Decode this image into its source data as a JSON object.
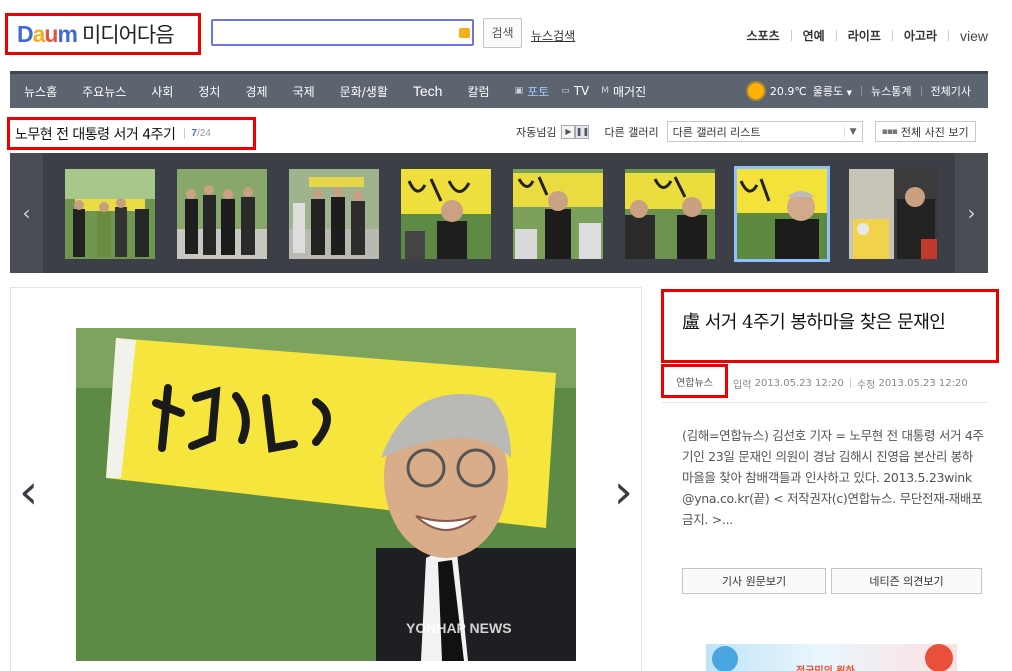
{
  "header": {
    "logo_letters": [
      "D",
      "a",
      "u",
      "m"
    ],
    "logo_colors": [
      "#3d6bd6",
      "#f2b01b",
      "#e8503a",
      "#3d6bd6"
    ],
    "brand_text": "미디어다음",
    "search_placeholder": "",
    "search_button": "검색",
    "news_search": "뉴스검색",
    "top_links": [
      "스포츠",
      "연예",
      "라이프",
      "아고라",
      "view"
    ]
  },
  "nav": {
    "items": [
      "뉴스홈",
      "주요뉴스",
      "사회",
      "정치",
      "경제",
      "국제",
      "문화/생활",
      "Tech",
      "칼럼"
    ],
    "sub_items": [
      {
        "icon": "photo-icon",
        "label": "포토",
        "active": true
      },
      {
        "icon": "tv-icon",
        "label": "TV",
        "active": false
      },
      {
        "icon": "magazine-icon",
        "label": "매거진",
        "active": false
      }
    ],
    "weather_temp": "20.9℃",
    "weather_region": "울릉도",
    "stats": "뉴스통계",
    "all_articles": "전체기사"
  },
  "gallery": {
    "title": "노무현 전 대통령 서거 4주기",
    "current": "7",
    "total": "/24",
    "auto_label": "자동넘김",
    "other_gallery_label": "다른 갤러리",
    "select_value": "다른 갤러리 리스트",
    "all_photos": "전체 사진 보기",
    "thumbnail_count": 9,
    "selected_index": 6
  },
  "photo": {
    "banner_text": "故 노무현",
    "watermark": "YONHAP NEWS"
  },
  "article": {
    "headline": "盧 서거 4주기 봉하마을 찾은 문재인",
    "source": "연합뉴스",
    "input_label": "입력",
    "input_time": "2013.05.23 12:20",
    "modified_label": "수정",
    "modified_time": "2013.05.23 12:20",
    "body": "(김해=연합뉴스) 김선호 기자 = 노무현 전 대통령 서거 4주기인 23일 문재인 의원이 경남 김해시 진영읍 본산리 봉하마을을 찾아 참배객들과 인사하고 있다. 2013.5.23wink@yna.co.kr(끝) < 저작권자(c)연합뉴스. 무단전재-재배포금지. >...",
    "btn_original": "기사 원문보기",
    "btn_comments": "네티즌 의견보기",
    "ad_text": "전국민의 원하"
  },
  "colors": {
    "nav_bg": "#5c6470",
    "strip_bg": "#3c3f45",
    "highlight_border": "#e00000",
    "selected_thumb": "#8fc0ff",
    "banner_yellow": "#f5e53c"
  }
}
